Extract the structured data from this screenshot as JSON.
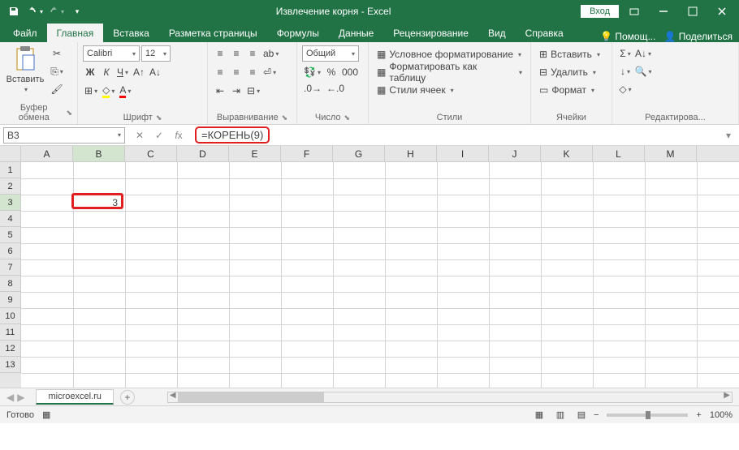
{
  "title": "Извлечение корня  -  Excel",
  "login": "Вход",
  "tabs": [
    "Файл",
    "Главная",
    "Вставка",
    "Разметка страницы",
    "Формулы",
    "Данные",
    "Рецензирование",
    "Вид",
    "Справка"
  ],
  "active_tab_index": 1,
  "tell_me": "Помощ...",
  "share": "Поделиться",
  "groups": {
    "clipboard": "Буфер обмена",
    "font": "Шрифт",
    "alignment": "Выравнивание",
    "number": "Число",
    "styles": "Стили",
    "cells": "Ячейки",
    "editing": "Редактирова..."
  },
  "paste": "Вставить",
  "font_name": "Calibri",
  "font_size": "12",
  "number_format": "Общий",
  "styles": {
    "cond": "Условное форматирование",
    "table": "Форматировать как таблицу",
    "cell": "Стили ячеек"
  },
  "cells_btns": {
    "insert": "Вставить",
    "delete": "Удалить",
    "format": "Формат"
  },
  "name_box": "B3",
  "formula": "=КОРЕНЬ(9)",
  "columns": [
    "A",
    "B",
    "C",
    "D",
    "E",
    "F",
    "G",
    "H",
    "I",
    "J",
    "K",
    "L",
    "M"
  ],
  "rows": [
    "1",
    "2",
    "3",
    "4",
    "5",
    "6",
    "7",
    "8",
    "9",
    "10",
    "11",
    "12",
    "13"
  ],
  "active_cell": {
    "col": 1,
    "row": 2,
    "value": "3"
  },
  "sheet_name": "microexcel.ru",
  "status": "Готово",
  "zoom": "100%"
}
